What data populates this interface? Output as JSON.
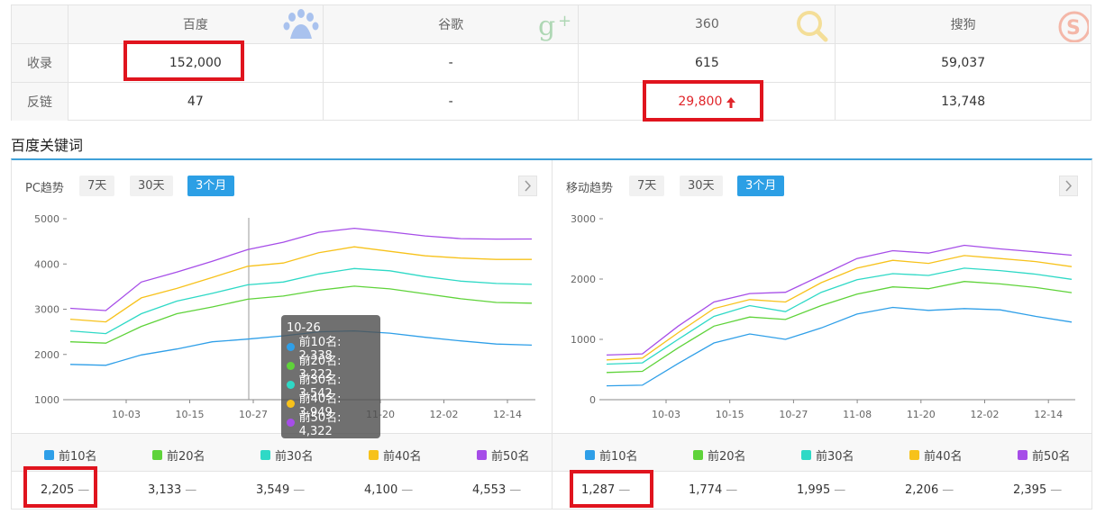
{
  "table": {
    "headers": [
      "百度",
      "谷歌",
      "360",
      "搜狗"
    ],
    "rows": [
      {
        "label": "收录",
        "values": [
          "152,000",
          "-",
          "615",
          "59,037"
        ]
      },
      {
        "label": "反链",
        "values": [
          "47",
          "-",
          "29,800",
          "13,748"
        ]
      }
    ]
  },
  "section_title": "百度关键词",
  "legend": [
    "前10名",
    "前20名",
    "前30名",
    "前40名",
    "前50名"
  ],
  "colors": {
    "series": [
      "#2f9fe8",
      "#5fd33a",
      "#2ed9c6",
      "#f7c21b",
      "#a64de8"
    ],
    "accent": "#2c9fe5",
    "highlight": "#e0141e",
    "alert": "#e0252a"
  },
  "tabs": [
    "7天",
    "30天",
    "3个月"
  ],
  "pc": {
    "title": "PC趋势",
    "current_values": [
      "2,205",
      "3,133",
      "3,549",
      "4,100",
      "4,553"
    ],
    "tooltip": {
      "date": "10-26",
      "items": [
        "前10名: 2,338",
        "前20名: 3,222",
        "前30名: 3,542",
        "前40名: 3,949",
        "前50名: 4,322"
      ]
    }
  },
  "mobile": {
    "title": "移动趋势",
    "current_values": [
      "1,287",
      "1,774",
      "1,995",
      "2,206",
      "2,395"
    ]
  },
  "chart_data": [
    {
      "type": "line",
      "name": "PC趋势",
      "ylim": [
        1000,
        5000
      ],
      "yticks": [
        1000,
        2000,
        3000,
        4000,
        5000
      ],
      "xticks": [
        "10-03",
        "10-15",
        "10-27",
        "11-08",
        "11-20",
        "12-02",
        "12-14"
      ],
      "x": [
        "09-19",
        "09-26",
        "10-03",
        "10-10",
        "10-17",
        "10-24",
        "10-31",
        "11-07",
        "11-14",
        "11-21",
        "11-28",
        "12-05",
        "12-12",
        "12-17"
      ],
      "series": [
        {
          "name": "前10名",
          "values": [
            1780,
            1760,
            1990,
            2120,
            2280,
            2340,
            2410,
            2500,
            2520,
            2470,
            2380,
            2300,
            2230,
            2205
          ]
        },
        {
          "name": "前20名",
          "values": [
            2280,
            2250,
            2620,
            2900,
            3050,
            3220,
            3290,
            3420,
            3510,
            3450,
            3340,
            3230,
            3150,
            3133
          ]
        },
        {
          "name": "前30名",
          "values": [
            2520,
            2460,
            2900,
            3180,
            3350,
            3540,
            3600,
            3780,
            3900,
            3850,
            3720,
            3620,
            3570,
            3549
          ]
        },
        {
          "name": "前40名",
          "values": [
            2780,
            2720,
            3250,
            3460,
            3700,
            3950,
            4020,
            4250,
            4380,
            4280,
            4180,
            4130,
            4100,
            4100
          ]
        },
        {
          "name": "前50名",
          "values": [
            3020,
            2970,
            3600,
            3820,
            4060,
            4320,
            4480,
            4700,
            4790,
            4710,
            4620,
            4560,
            4550,
            4553
          ]
        }
      ]
    },
    {
      "type": "line",
      "name": "移动趋势",
      "ylim": [
        0,
        3000
      ],
      "yticks": [
        0,
        1000,
        2000,
        3000
      ],
      "xticks": [
        "10-03",
        "10-15",
        "10-27",
        "11-08",
        "11-20",
        "12-02",
        "12-14"
      ],
      "x": [
        "09-19",
        "09-26",
        "10-03",
        "10-10",
        "10-17",
        "10-24",
        "10-31",
        "11-07",
        "11-14",
        "11-21",
        "11-28",
        "12-05",
        "12-12",
        "12-17"
      ],
      "series": [
        {
          "name": "前10名",
          "values": [
            230,
            240,
            600,
            940,
            1090,
            1000,
            1190,
            1420,
            1530,
            1480,
            1510,
            1490,
            1380,
            1287
          ]
        },
        {
          "name": "前20名",
          "values": [
            450,
            470,
            860,
            1220,
            1370,
            1330,
            1560,
            1750,
            1870,
            1840,
            1960,
            1920,
            1860,
            1774
          ]
        },
        {
          "name": "前30名",
          "values": [
            590,
            610,
            1000,
            1380,
            1560,
            1460,
            1780,
            1990,
            2090,
            2060,
            2180,
            2140,
            2080,
            1995
          ]
        },
        {
          "name": "前40名",
          "values": [
            660,
            690,
            1110,
            1510,
            1660,
            1620,
            1940,
            2180,
            2310,
            2260,
            2390,
            2340,
            2290,
            2206
          ]
        },
        {
          "name": "前50名",
          "values": [
            740,
            760,
            1220,
            1620,
            1760,
            1780,
            2060,
            2340,
            2470,
            2430,
            2560,
            2500,
            2450,
            2395
          ]
        }
      ]
    }
  ]
}
